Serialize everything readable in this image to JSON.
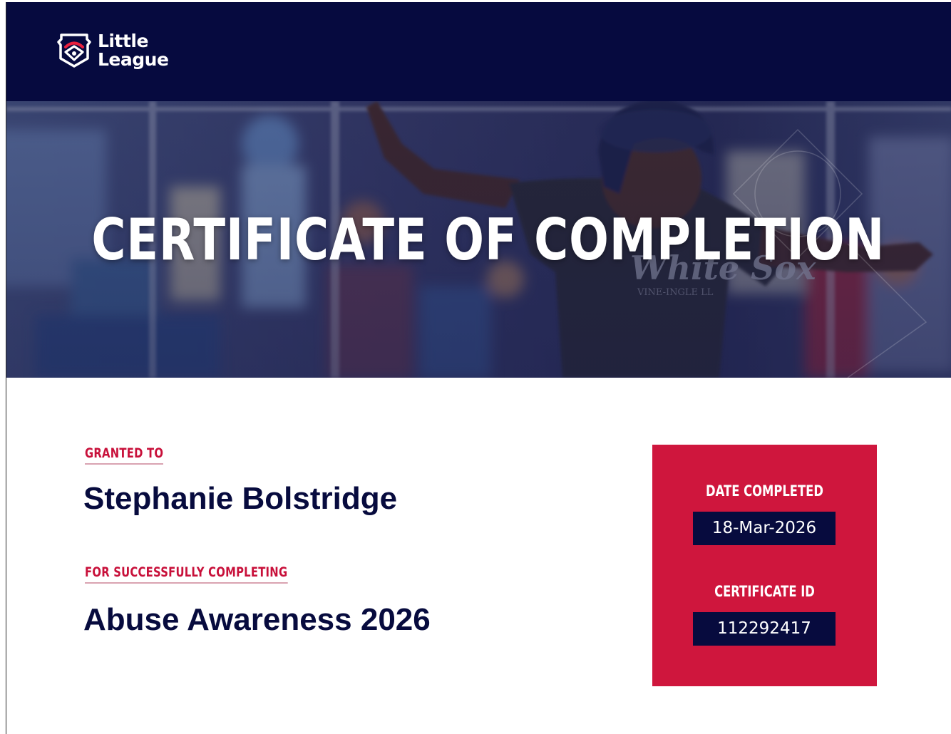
{
  "header": {
    "logo_line1": "Little",
    "logo_line2": "League",
    "background_color": "#060a3f"
  },
  "hero": {
    "title": "CERTIFICATE OF COMPLETION"
  },
  "recipient": {
    "label": "GRANTED TO",
    "name": "Stephanie Bolstridge"
  },
  "course": {
    "label": "FOR SUCCESSFULLY COMPLETING",
    "name": "Abuse Awareness 2026"
  },
  "details": {
    "date_label": "DATE COMPLETED",
    "date_value": "18-Mar-2026",
    "id_label": "CERTIFICATE ID",
    "id_value": "112292417",
    "box_color": "#cf163d"
  },
  "colors": {
    "navy": "#070b3e",
    "red": "#c8103a"
  }
}
